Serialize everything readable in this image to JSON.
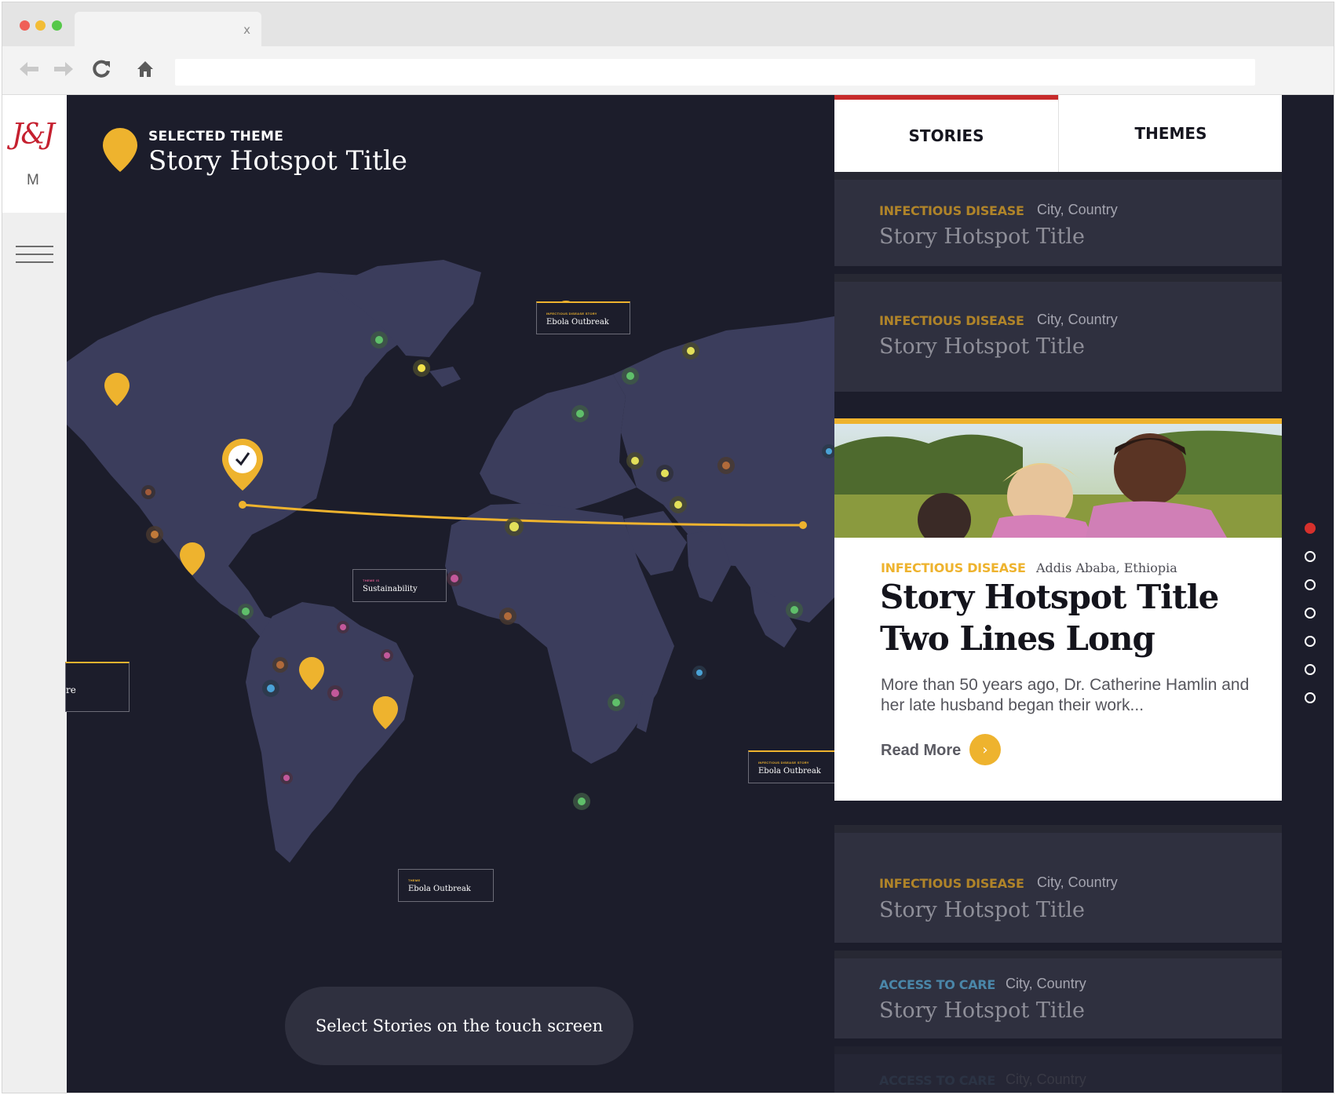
{
  "browser": {
    "tab_close": "x",
    "traffic_colors": [
      "#ef5f57",
      "#f3bd36",
      "#56c84a"
    ]
  },
  "sidebar": {
    "logo_script": "J&J",
    "logo_letter": "M"
  },
  "header": {
    "theme_label": "SELECTED THEME",
    "theme_title": "Story Hotspot Title"
  },
  "map": {
    "labels": [
      {
        "kicker": "INFECTIOUS DISEASE STORY",
        "text": "Ebola Outbreak",
        "kicker_color": "#eeb32e"
      },
      {
        "kicker": "THEME IS",
        "text": "Sustainability",
        "kicker_color": "#d6558a"
      },
      {
        "kicker": "",
        "text": "re",
        "kicker_color": "#eeb32e"
      },
      {
        "kicker": "INFECTIOUS DISEASE STORY",
        "text": "Ebola Outbreak",
        "kicker_color": "#eeb32e"
      },
      {
        "kicker": "THEME",
        "text": "Ebola Outbreak",
        "kicker_color": "#eeb32e"
      }
    ],
    "touch_prompt": "Select Stories on the touch screen",
    "accent_color": "#eeb32e",
    "land_color": "#3b3d5c"
  },
  "tabs": {
    "stories": "STORIES",
    "themes": "THEMES"
  },
  "stories": [
    {
      "category": "INFECTIOUS DISEASE",
      "location": "City, Country",
      "title": "Story Hotspot Title",
      "category_color": "#b08429"
    },
    {
      "category": "INFECTIOUS DISEASE",
      "location": "City, Country",
      "title": "Story Hotspot Title",
      "category_color": "#b08429"
    },
    {
      "category": "INFECTIOUS DISEASE",
      "location": "City, Country",
      "title": "Story Hotspot Title",
      "category_color": "#b08429"
    },
    {
      "category": "ACCESS TO CARE",
      "location": "City, Country",
      "title": "Story Hotspot Title",
      "category_color": "#4a86a8"
    },
    {
      "category": "ACCESS TO CARE",
      "location": "City, Country",
      "title": "",
      "category_color": "#3a4a5e"
    }
  ],
  "featured": {
    "category": "INFECTIOUS DISEASE",
    "location": "Addis Ababa, Ethiopia",
    "title": "Story Hotspot Title Two Lines Long",
    "excerpt": "More than 50 years ago, Dr. Catherine Hamlin and her late husband began their work...",
    "read_more": "Read More"
  },
  "pager": {
    "count": 7,
    "active": 0
  }
}
